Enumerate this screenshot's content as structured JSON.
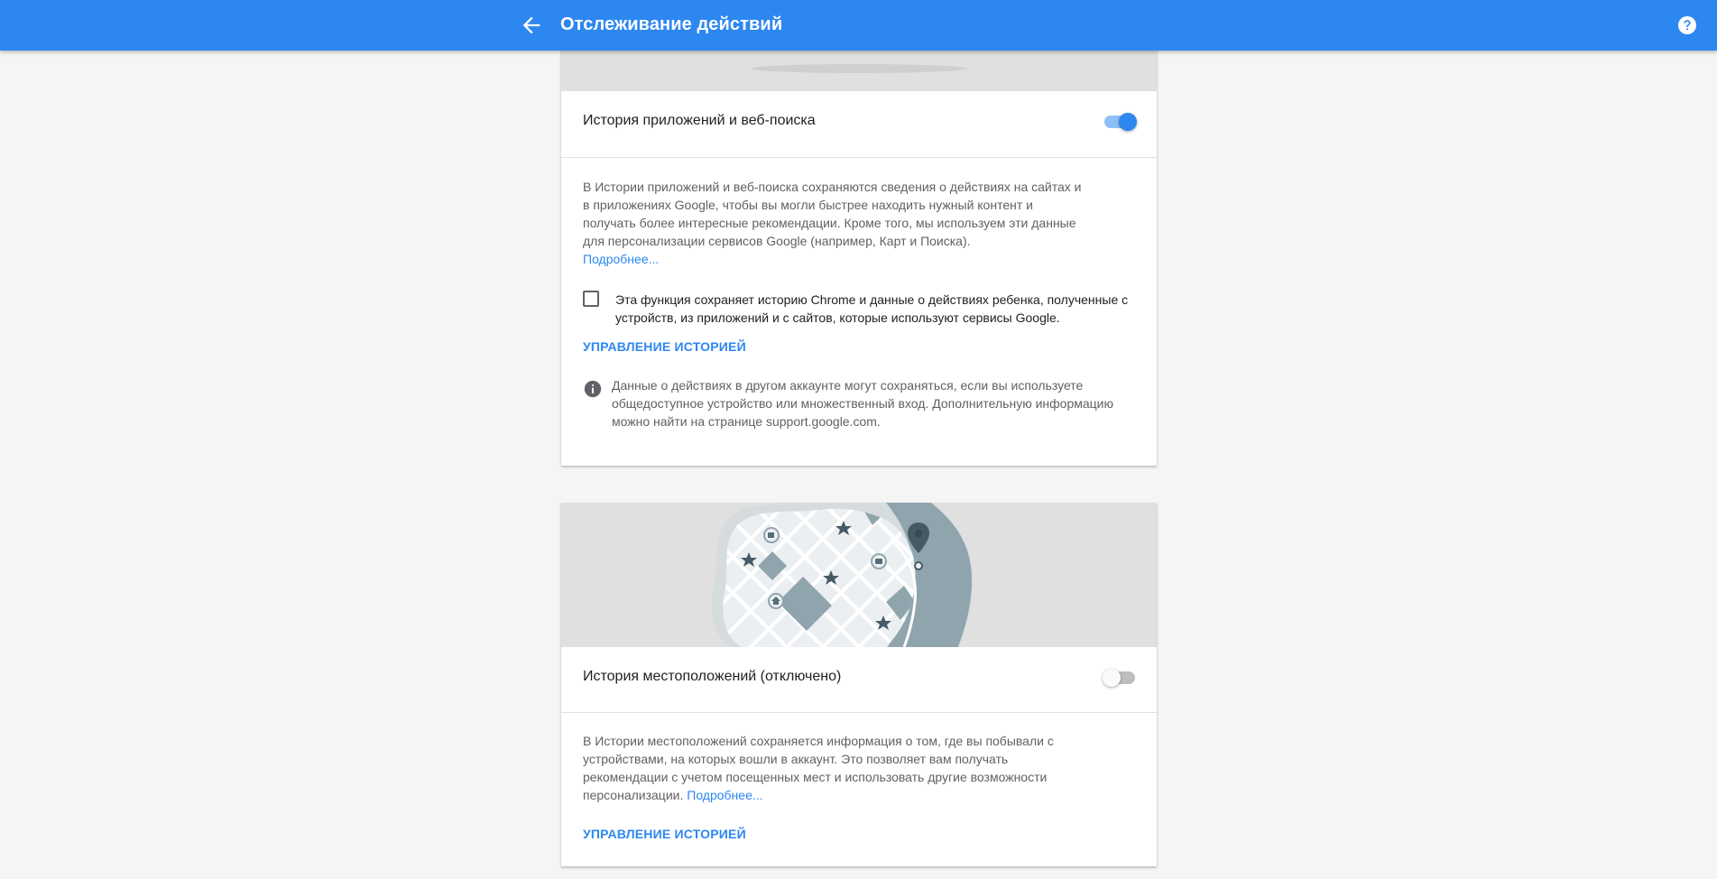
{
  "header": {
    "title": "Отслеживание действий"
  },
  "cards": [
    {
      "title": "История приложений и веб-поиска",
      "toggle_on": true,
      "description": "В Истории приложений и веб-поиска сохраняются сведения о действиях на сайтах и в приложениях Google, чтобы вы могли быстрее находить нужный контент и получать более интересные рекомендации. Кроме того, мы используем эти данные для персонализации сервисов Google (например, Карт и Поиска).",
      "learn_more": "Подробнее...",
      "checkbox_label": "Эта функция сохраняет историю Chrome и данные о действиях ребенка, полученные с устройств, из приложений и с сайтов, которые используют сервисы Google.",
      "checkbox_checked": false,
      "manage_label": "УПРАВЛЕНИЕ ИСТОРИЕЙ",
      "info_text": "Данные о действиях в другом аккаунте могут сохраняться, если вы используете общедоступное устройство или множественный вход. Дополнительную информацию можно найти на странице support.google.com."
    },
    {
      "title": "История местоположений (отключено)",
      "toggle_on": false,
      "description": "В Истории местоположений сохраняется информация о том, где вы побывали с устройствами, на которых вошли в аккаунт. Это позволяет вам получать рекомендации с учетом посещенных мест и использовать другие возможности персонализации.",
      "learn_more": "Подробнее...",
      "manage_label": "УПРАВЛЕНИЕ ИСТОРИЕЙ"
    }
  ],
  "colors": {
    "brand": "#2d87f0",
    "map_water": "#90a4ae",
    "map_land": "#eceff1",
    "map_dark": "#455a64"
  },
  "icons": {
    "back": "arrow-back-icon",
    "help": "help-circle-icon",
    "info": "info-icon",
    "map_pin": "map-pin-icon",
    "star": "star-icon",
    "home": "home-icon",
    "camera": "camera-icon",
    "cafe": "cafe-icon"
  }
}
